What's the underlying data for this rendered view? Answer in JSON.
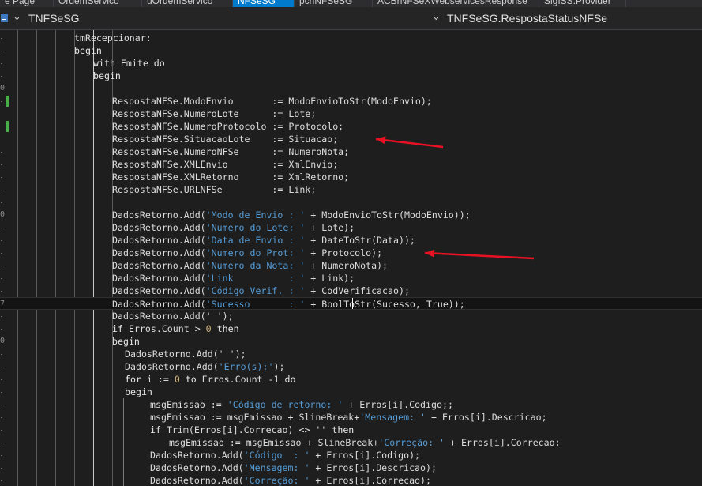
{
  "tabs": [
    {
      "label": "e Page",
      "active": false
    },
    {
      "label": "OrdemServico",
      "active": false
    },
    {
      "label": "uOrdemServico",
      "active": false
    },
    {
      "label": "NFSeSG",
      "active": true
    },
    {
      "label": "pcnNFSeSG",
      "active": false
    },
    {
      "label": "ACBrNFSeXWebservicesResponse",
      "active": false
    },
    {
      "label": "SigISS.Provider",
      "active": false
    }
  ],
  "navbar": {
    "class_label": "TNFSeSG",
    "method_label": "TNFSeSG.RespostaStatusNFSe"
  },
  "gutter_numbers": [
    "0",
    "0",
    "0",
    "7",
    "0"
  ],
  "lines": [
    [
      {
        "t": "tmRecepcionar:"
      }
    ],
    [
      {
        "t": "begin",
        "c": "kw"
      }
    ],
    [
      {
        "t": "with",
        "c": "kw"
      },
      {
        "t": " Emite "
      },
      {
        "t": "do",
        "c": "kw"
      }
    ],
    [
      {
        "t": "begin",
        "c": "kw"
      }
    ],
    [],
    [
      {
        "t": "RespostaNFSe.ModoEnvio       := ModoEnvioToStr(ModoEnvio);"
      }
    ],
    [
      {
        "t": "RespostaNFSe.NumeroLote      := Lote;"
      }
    ],
    [
      {
        "t": "RespostaNFSe.NumeroProtocolo := Protocolo;"
      }
    ],
    [
      {
        "t": "RespostaNFSe.SituacaoLote    := Situacao;"
      }
    ],
    [
      {
        "t": "RespostaNFSe.NumeroNFSe      := NumeroNota;"
      }
    ],
    [
      {
        "t": "RespostaNFSe.XMLEnvio        := XmlEnvio;"
      }
    ],
    [
      {
        "t": "RespostaNFSe.XMLRetorno      := XmlRetorno;"
      }
    ],
    [
      {
        "t": "RespostaNFSe.URLNFSe         := Link;"
      }
    ],
    [],
    [
      {
        "t": "DadosRetorno.Add("
      },
      {
        "t": "'Modo de Envio : '",
        "c": "str"
      },
      {
        "t": " + ModoEnvioToStr(ModoEnvio));"
      }
    ],
    [
      {
        "t": "DadosRetorno.Add("
      },
      {
        "t": "'Numero do Lote: '",
        "c": "str"
      },
      {
        "t": " + Lote);"
      }
    ],
    [
      {
        "t": "DadosRetorno.Add("
      },
      {
        "t": "'Data de Envio : '",
        "c": "str"
      },
      {
        "t": " + DateToStr(Data));"
      }
    ],
    [
      {
        "t": "DadosRetorno.Add("
      },
      {
        "t": "'Numero do Prot: '",
        "c": "str"
      },
      {
        "t": " + Protocolo);"
      }
    ],
    [
      {
        "t": "DadosRetorno.Add("
      },
      {
        "t": "'Numero da Nota: '",
        "c": "str"
      },
      {
        "t": " + NumeroNota);"
      }
    ],
    [
      {
        "t": "DadosRetorno.Add("
      },
      {
        "t": "'Link          : '",
        "c": "str"
      },
      {
        "t": " + Link);"
      }
    ],
    [
      {
        "t": "DadosRetorno.Add("
      },
      {
        "t": "'Código Verif. : '",
        "c": "str"
      },
      {
        "t": " + CodVerificacao);"
      }
    ],
    [
      {
        "t": "DadosRetorno.Add("
      },
      {
        "t": "'Sucesso       : '",
        "c": "str"
      },
      {
        "t": " + BoolToStr(Sucesso, True));"
      }
    ],
    [
      {
        "t": "DadosRetorno.Add(' ');"
      }
    ],
    [
      {
        "t": "if",
        "c": "kw"
      },
      {
        "t": " Erros.Count > "
      },
      {
        "t": "0",
        "c": "num"
      },
      {
        "t": " "
      },
      {
        "t": "then",
        "c": "kw"
      }
    ],
    [
      {
        "t": "begin",
        "c": "kw"
      }
    ],
    [
      {
        "t": "DadosRetorno.Add(' ');"
      }
    ],
    [
      {
        "t": "DadosRetorno.Add("
      },
      {
        "t": "'Erro(s):'",
        "c": "str"
      },
      {
        "t": ");"
      }
    ],
    [
      {
        "t": "for",
        "c": "kw"
      },
      {
        "t": " i := "
      },
      {
        "t": "0",
        "c": "num"
      },
      {
        "t": " "
      },
      {
        "t": "to",
        "c": "kw"
      },
      {
        "t": " Erros.Count -1 "
      },
      {
        "t": "do",
        "c": "kw"
      }
    ],
    [
      {
        "t": "begin",
        "c": "kw"
      }
    ],
    [
      {
        "t": "msgEmissao := "
      },
      {
        "t": "'Código de retorno: '",
        "c": "str"
      },
      {
        "t": " + Erros[i].Codigo;;"
      }
    ],
    [
      {
        "t": "msgEmissao := msgEmissao + SlineBreak+"
      },
      {
        "t": "'Mensagem: '",
        "c": "str"
      },
      {
        "t": " + Erros[i].Descricao;"
      }
    ],
    [
      {
        "t": "if",
        "c": "kw"
      },
      {
        "t": " Trim(Erros[i].Correcao) <> '' "
      },
      {
        "t": "then",
        "c": "kw"
      }
    ],
    [
      {
        "t": "msgEmissao := msgEmissao + SlineBreak+"
      },
      {
        "t": "'Correção: '",
        "c": "str"
      },
      {
        "t": " + Erros[i].Correcao;"
      }
    ],
    [
      {
        "t": "DadosRetorno.Add("
      },
      {
        "t": "'Código  : '",
        "c": "str"
      },
      {
        "t": " + Erros[i].Codigo);"
      }
    ],
    [
      {
        "t": "DadosRetorno.Add("
      },
      {
        "t": "'Mensagem: '",
        "c": "str"
      },
      {
        "t": " + Erros[i].Descricao);"
      }
    ],
    [
      {
        "t": "DadosRetorno.Add("
      },
      {
        "t": "'Correção: '",
        "c": "str"
      },
      {
        "t": " + Erros[i].Correcao);"
      }
    ]
  ],
  "colors": {
    "background": "#1e1e1e",
    "text": "#dcdcdc",
    "string": "#569cd6",
    "number": "#d7ba7d",
    "active_tab": "#007acc",
    "annotation_arrow": "#e81123",
    "change_marker": "#47b047"
  },
  "icons": [
    "class-browser-icon",
    "chevron-down-icon",
    "annotation-arrow"
  ]
}
